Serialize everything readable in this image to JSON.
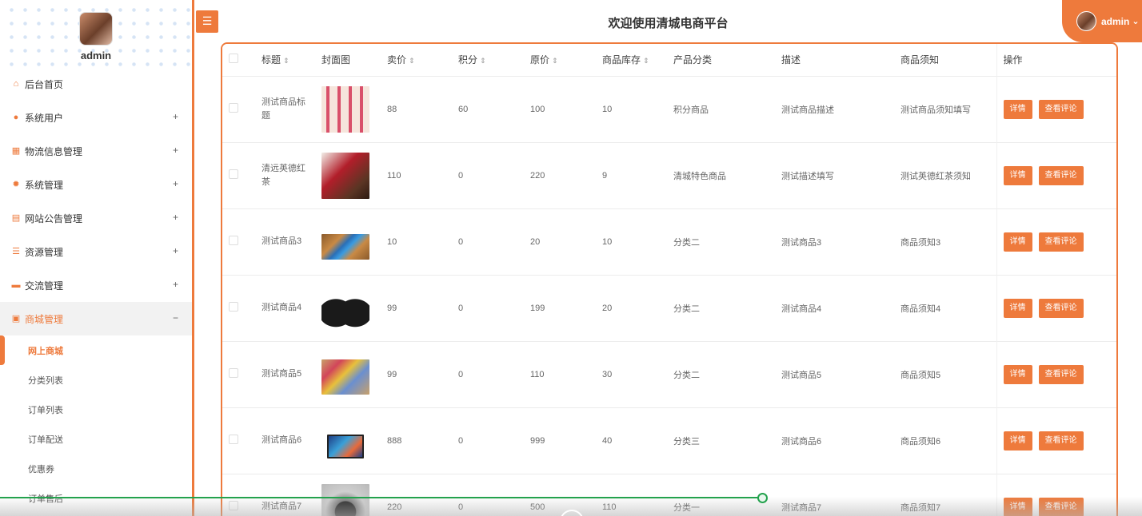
{
  "sidebar": {
    "username": "admin",
    "menu": [
      {
        "label": "后台首页",
        "icon": "home-icon",
        "glyph": "⌂",
        "expandable": false
      },
      {
        "label": "系统用户",
        "icon": "user-icon",
        "glyph": "●",
        "expandable": true,
        "toggle": "+"
      },
      {
        "label": "物流信息管理",
        "icon": "grid-icon",
        "glyph": "▦",
        "expandable": true,
        "toggle": "+"
      },
      {
        "label": "系统管理",
        "icon": "gear-icon",
        "glyph": "✹",
        "expandable": true,
        "toggle": "+"
      },
      {
        "label": "网站公告管理",
        "icon": "document-icon",
        "glyph": "▤",
        "expandable": true,
        "toggle": "+"
      },
      {
        "label": "资源管理",
        "icon": "database-icon",
        "glyph": "☰",
        "expandable": true,
        "toggle": "+"
      },
      {
        "label": "交流管理",
        "icon": "chat-icon",
        "glyph": "▬",
        "expandable": true,
        "toggle": "+"
      },
      {
        "label": "商城管理",
        "icon": "shop-icon",
        "glyph": "▣",
        "expandable": true,
        "toggle": "−"
      }
    ],
    "submenu": [
      "网上商城",
      "分类列表",
      "订单列表",
      "订单配送",
      "优惠券",
      "订单售后"
    ]
  },
  "header": {
    "title": "欢迎使用清城电商平台",
    "menu_glyph": "☰",
    "user": "admin",
    "dropdown_glyph": "⌄"
  },
  "table": {
    "columns": [
      "标题",
      "封面图",
      "卖价",
      "积分",
      "原价",
      "商品库存",
      "产品分类",
      "描述",
      "商品须知",
      "操作"
    ],
    "sort_glyph": "⇕",
    "actions": {
      "detail": "详情",
      "comments": "查看评论"
    },
    "rows": [
      {
        "title": "测试商品标题",
        "image": "lipstick-image",
        "price": "88",
        "points": "60",
        "original": "100",
        "stock": "10",
        "category": "积分商品",
        "desc": "测试商品描述",
        "notice": "测试商品须知填写"
      },
      {
        "title": "清远英德红茶",
        "image": "tea-package-image",
        "price": "110",
        "points": "0",
        "original": "220",
        "stock": "9",
        "category": "清城特色商品",
        "desc": "测试描述填写",
        "notice": "测试英德红茶须知"
      },
      {
        "title": "测试商品3",
        "image": "tablet-image",
        "price": "10",
        "points": "0",
        "original": "20",
        "stock": "10",
        "category": "分类二",
        "desc": "测试商品3",
        "notice": "商品须知3"
      },
      {
        "title": "测试商品4",
        "image": "shampoo-bottles-image",
        "price": "99",
        "points": "0",
        "original": "199",
        "stock": "20",
        "category": "分类二",
        "desc": "测试商品4",
        "notice": "商品须知4"
      },
      {
        "title": "测试商品5",
        "image": "snack-box-image",
        "price": "99",
        "points": "0",
        "original": "110",
        "stock": "30",
        "category": "分类二",
        "desc": "测试商品5",
        "notice": "商品须知5"
      },
      {
        "title": "测试商品6",
        "image": "monitor-image",
        "price": "888",
        "points": "0",
        "original": "999",
        "stock": "40",
        "category": "分类三",
        "desc": "测试商品6",
        "notice": "商品须知6"
      },
      {
        "title": "测试商品7",
        "image": "washing-machine-image",
        "price": "220",
        "points": "0",
        "original": "500",
        "stock": "110",
        "category": "分类一",
        "desc": "测试商品7",
        "notice": "商品须知7"
      }
    ]
  },
  "colors": {
    "accent": "#ee7a3c",
    "progress": "#23a24d"
  }
}
